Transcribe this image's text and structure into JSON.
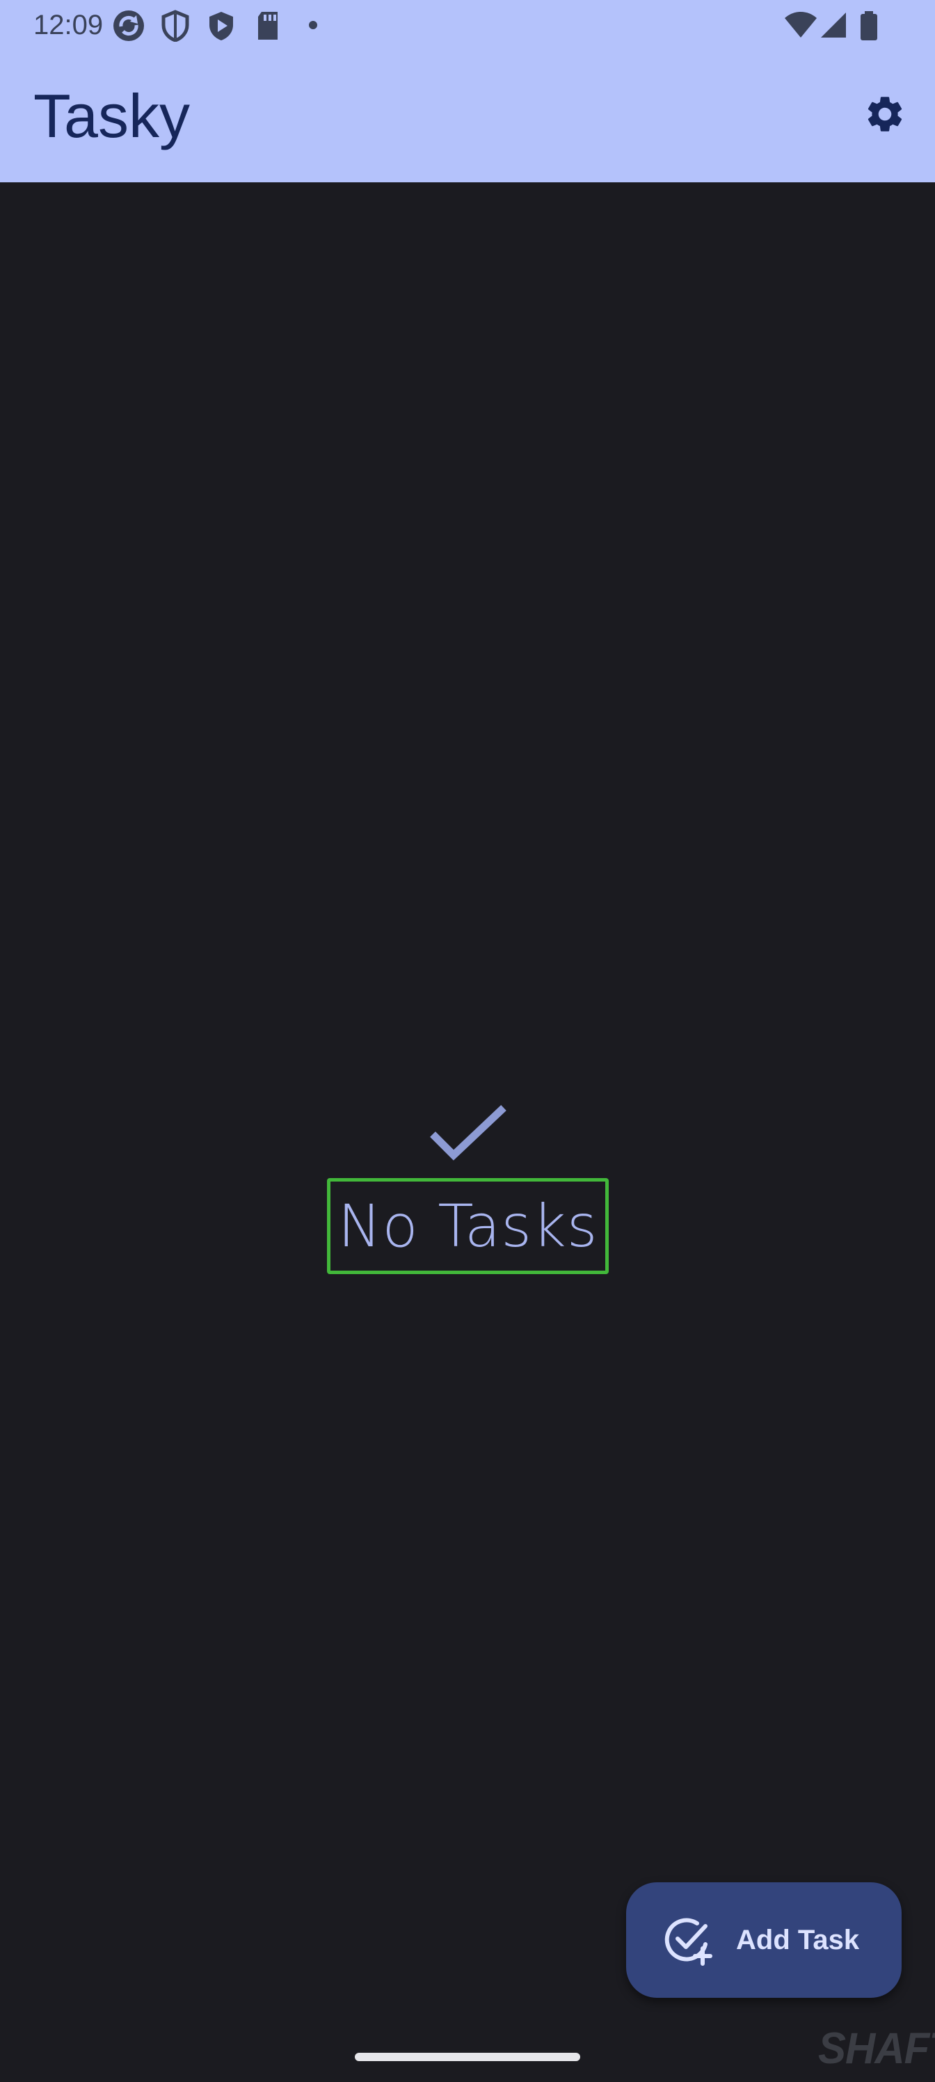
{
  "status_bar": {
    "time": "12:09",
    "left_icons": [
      "sync-icon",
      "shield-icon",
      "play-protect-icon",
      "sd-card-icon",
      "dot-icon"
    ],
    "right_icons": [
      "wifi-icon",
      "signal-icon",
      "battery-icon"
    ]
  },
  "app_bar": {
    "title": "Tasky",
    "settings_icon": "gear-icon",
    "background_color": "#b4c2fb",
    "title_color": "#16265a"
  },
  "empty_state": {
    "icon": "check-icon",
    "label": "No Tasks",
    "label_color": "#a9b5ef",
    "highlight_color": "#42b83a"
  },
  "fab": {
    "icon": "add-task-icon",
    "label": "Add Task",
    "background_color": "#33447c"
  },
  "watermark": {
    "text": "SHAFT"
  },
  "colors": {
    "background": "#1b1b20"
  }
}
